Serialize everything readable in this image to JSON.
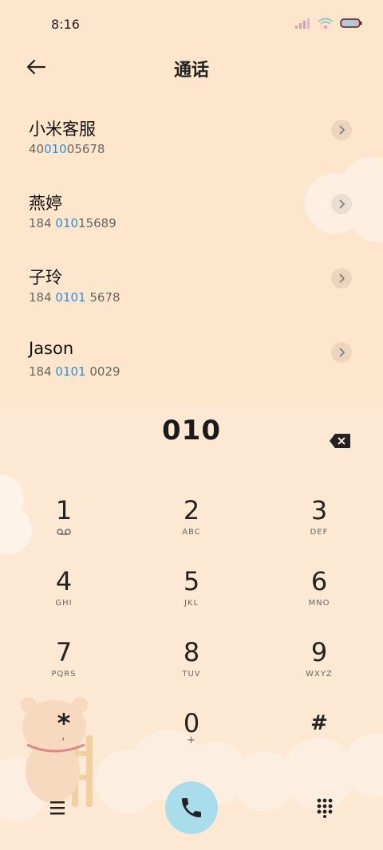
{
  "status": {
    "time": "8:16"
  },
  "header": {
    "title": "通话"
  },
  "contacts": [
    {
      "name": "小米客服",
      "num_pre": "40",
      "num_hl": "010",
      "num_post": "05678"
    },
    {
      "name": "燕婷",
      "num_pre": "184 ",
      "num_hl": "010",
      "num_post": "15689"
    },
    {
      "name": "子玲",
      "num_pre": "184 ",
      "num_hl": "0101",
      "num_post": " 5678"
    },
    {
      "name": "Jason",
      "num_pre": "184 ",
      "num_hl": "0101",
      "num_post": " 0029"
    }
  ],
  "dialer": {
    "input": "010",
    "keys": [
      {
        "digit": "1",
        "letters": ""
      },
      {
        "digit": "2",
        "letters": "ABC"
      },
      {
        "digit": "3",
        "letters": "DEF"
      },
      {
        "digit": "4",
        "letters": "GHI"
      },
      {
        "digit": "5",
        "letters": "JKL"
      },
      {
        "digit": "6",
        "letters": "MNO"
      },
      {
        "digit": "7",
        "letters": "PQRS"
      },
      {
        "digit": "8",
        "letters": "TUV"
      },
      {
        "digit": "9",
        "letters": "WXYZ"
      },
      {
        "digit": "*",
        "letters": ","
      },
      {
        "digit": "0",
        "letters": "+"
      },
      {
        "digit": "#",
        "letters": ""
      }
    ]
  },
  "colors": {
    "background": "#fde6cc",
    "accent": "#2a8fd8",
    "call_button": "#a9ddeb"
  },
  "icons": [
    "wifi-icon",
    "signal-icon",
    "battery-icon",
    "back-arrow-icon",
    "chevron-right-icon",
    "backspace-icon",
    "voicemail-icon",
    "menu-icon",
    "phone-icon",
    "dialpad-icon"
  ]
}
